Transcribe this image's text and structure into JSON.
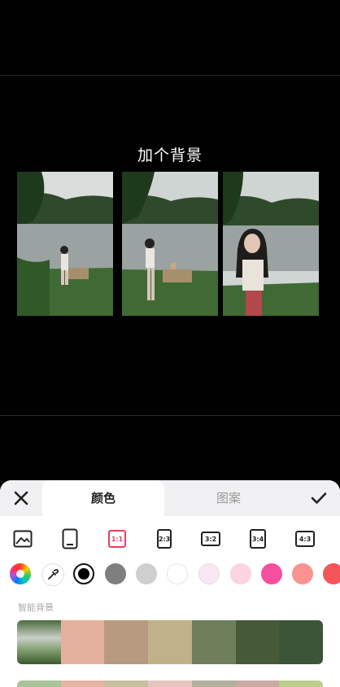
{
  "preview": {
    "title": "加个背景",
    "photos": [
      "photo-1",
      "photo-2",
      "photo-3"
    ]
  },
  "panel": {
    "close_icon": "close-icon",
    "confirm_icon": "check-icon",
    "tabs": [
      {
        "label": "颜色",
        "active": true
      },
      {
        "label": "图案",
        "active": false
      }
    ],
    "ratios": [
      {
        "icon": "image-icon",
        "label": ""
      },
      {
        "icon": "phone-icon",
        "label": ""
      },
      {
        "icon": "ratio-icon",
        "label": "1:1",
        "selected": true
      },
      {
        "icon": "ratio-icon",
        "label": "2:3"
      },
      {
        "icon": "ratio-icon",
        "label": "3:2"
      },
      {
        "icon": "ratio-icon",
        "label": "3:4"
      },
      {
        "icon": "ratio-icon",
        "label": "4:3"
      }
    ],
    "colors": [
      "#7f7f7f",
      "#cfcfcf",
      "#ffffff",
      "#f8e8f3",
      "#fbd3e3",
      "#f64fa0",
      "#f9938f",
      "#f3555a"
    ],
    "smart_bg_label": "智能背景",
    "smart_palette": [
      "#6f8a5c",
      "#e3b19d",
      "#b89a81",
      "#bfb289",
      "#6f7f5c",
      "#465a3a",
      "#3d5537"
    ],
    "second_palette": [
      "#a8c49a",
      "#e6b4a6",
      "#c9c0a2",
      "#e8c6c0",
      "#b3b09b",
      "#c9aba2",
      "#bcd08e"
    ]
  }
}
